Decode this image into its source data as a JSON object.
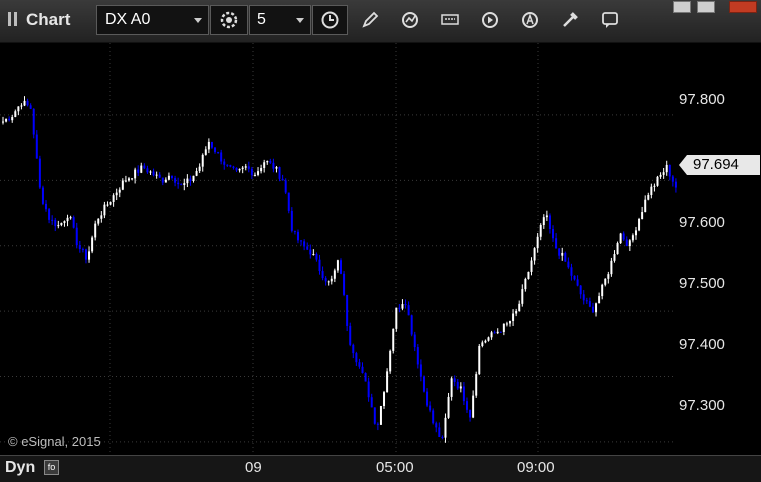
{
  "window": {
    "title": "Chart",
    "symbol": "DX A0",
    "interval": "5",
    "toolbar_icons": [
      "interval-settings-icon",
      "clock-icon",
      "pencil-icon",
      "refresh-icon",
      "studies-icon",
      "play-icon",
      "alert-icon",
      "tools-icon",
      "chat-icon"
    ],
    "window_buttons": [
      "restore-icon",
      "maximize-icon",
      "close-icon"
    ]
  },
  "chart": {
    "copyright": "© eSignal, 2015",
    "last_price": "97.694",
    "price_axis": [
      "97.800",
      "97.600",
      "97.500",
      "97.400",
      "97.300"
    ],
    "time_axis": [
      "09",
      "05:00",
      "09:00"
    ],
    "mode_label": "Dyn"
  },
  "colors": {
    "up": "#ffffff",
    "down": "#0000ff",
    "grid": "#3a3a3a",
    "background": "#000000"
  },
  "chart_data": {
    "type": "candlestick",
    "ylim": [
      97.28,
      97.91
    ],
    "y_ticks": [
      97.8,
      97.7,
      97.6,
      97.5,
      97.4,
      97.3
    ],
    "x_ticks": [
      "09",
      "05:00",
      "09:00"
    ],
    "close_path": [
      97.79,
      97.8,
      97.82,
      97.81,
      97.68,
      97.64,
      97.63,
      97.65,
      97.6,
      97.58,
      97.64,
      97.66,
      97.68,
      97.7,
      97.71,
      97.72,
      97.71,
      97.7,
      97.71,
      97.69,
      97.7,
      97.72,
      97.76,
      97.74,
      97.72,
      97.71,
      97.72,
      97.71,
      97.73,
      97.72,
      97.7,
      97.62,
      97.6,
      97.59,
      97.56,
      97.54,
      97.58,
      97.46,
      97.42,
      97.38,
      97.32,
      97.4,
      97.5,
      97.52,
      97.45,
      97.38,
      97.33,
      97.3,
      97.4,
      97.38,
      97.34,
      97.45,
      97.46,
      97.47,
      97.48,
      97.5,
      97.55,
      97.6,
      97.65,
      97.6,
      97.58,
      97.55,
      97.52,
      97.5,
      97.53,
      97.57,
      97.62,
      97.6,
      97.64,
      97.68,
      97.7,
      97.72,
      97.69
    ]
  }
}
